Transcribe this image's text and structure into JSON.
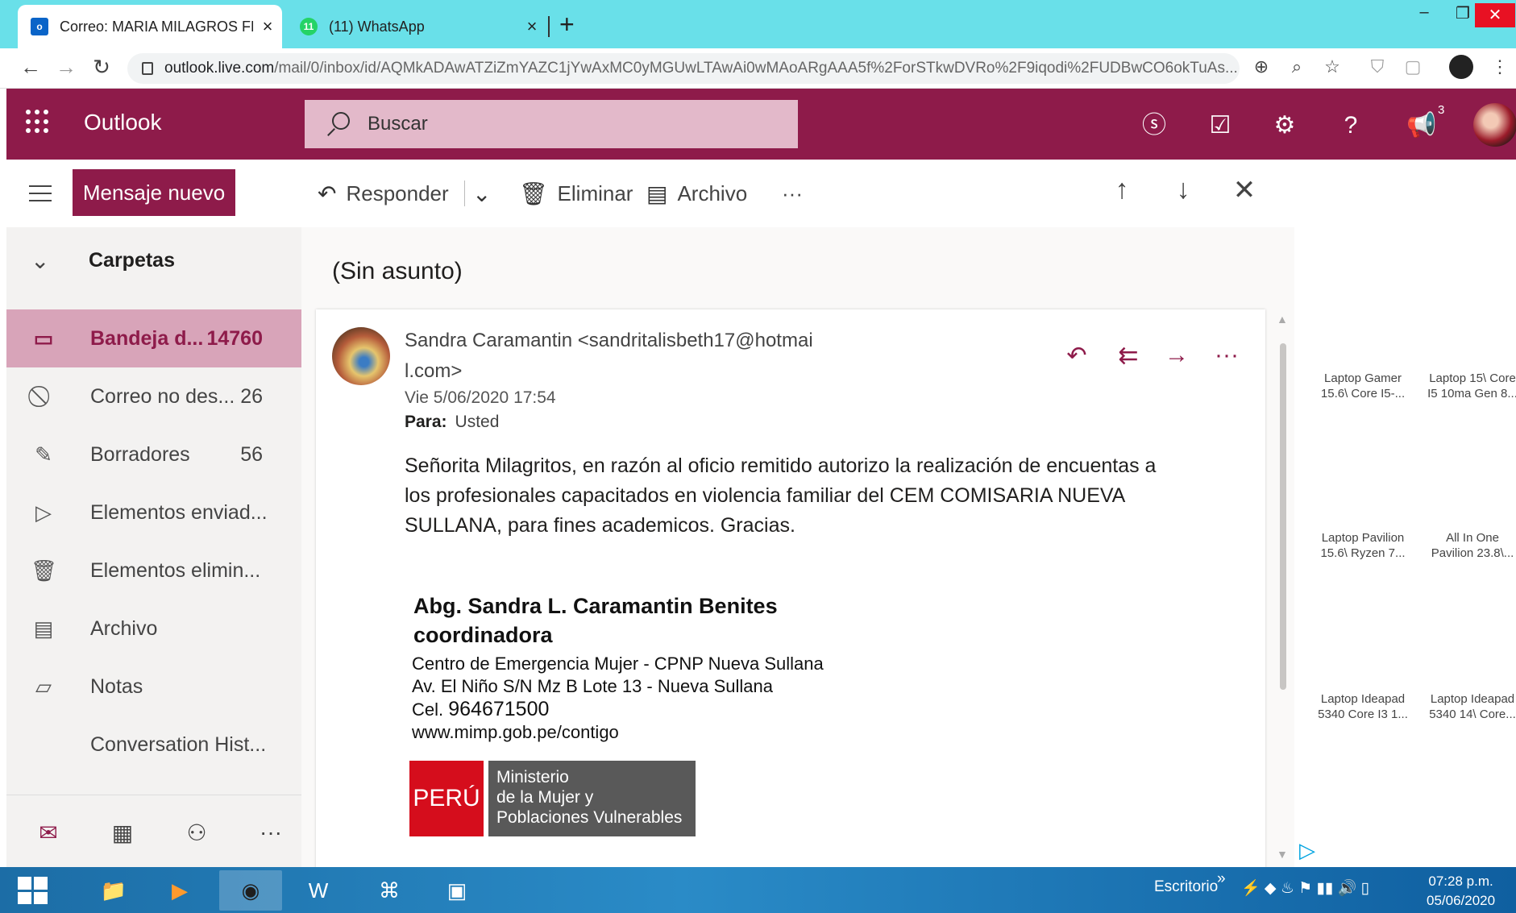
{
  "browser": {
    "tabs": [
      {
        "title": "Correo: MARIA MILAGROS FERNÁ",
        "favicon": "outlook-icon",
        "close": "×"
      },
      {
        "title": "(11) WhatsApp",
        "favicon": "whatsapp-icon",
        "badge": "11",
        "close": "×"
      }
    ],
    "new_tab": "+",
    "url_domain": "outlook.live.com",
    "url_path": "/mail/0/inbox/id/AQMkADAwATZiZmYAZC1jYwAxMC0yMGUwLTAwAi0wMAoARgAAA5f%2ForSTkwDVRo%2F9iqodi%2FUDBwCO6okTuAs..."
  },
  "outlook": {
    "brand": "Outlook",
    "search_placeholder": "Buscar",
    "notification_count": "3",
    "new_message": "Mensaje nuevo",
    "commands": {
      "reply": "Responder",
      "delete": "Eliminar",
      "archive": "Archivo",
      "more": "···"
    }
  },
  "sidebar": {
    "header": "Carpetas",
    "folders": [
      {
        "name": "Bandeja d...",
        "count": "14760",
        "icon": "inbox-icon"
      },
      {
        "name": "Correo no des...",
        "count": "26",
        "icon": "junk-icon"
      },
      {
        "name": "Borradores",
        "count": "56",
        "icon": "pencil-icon"
      },
      {
        "name": "Elementos enviad...",
        "count": "",
        "icon": "send-icon"
      },
      {
        "name": "Elementos elimin...",
        "count": "",
        "icon": "trash-icon"
      },
      {
        "name": "Archivo",
        "count": "",
        "icon": "archive-icon"
      },
      {
        "name": "Notas",
        "count": "",
        "icon": "note-icon"
      },
      {
        "name": "Conversation Hist...",
        "count": "",
        "icon": ""
      }
    ]
  },
  "message": {
    "subject": "(Sin asunto)",
    "sender_line1": "Sandra Caramantin <sandritalisbeth17@hotmai",
    "sender_line2": "l.com>",
    "date": "Vie 5/06/2020 17:54",
    "to_label": "Para:",
    "to_value": "Usted",
    "body_lines": [
      "Señorita Milagritos, en razón al oficio remitido autorizo la realización de encuentas a",
      "los profesionales capacitados en violencia familiar del CEM COMISARIA NUEVA",
      "SULLANA, para fines academicos. Gracias."
    ],
    "signature": {
      "name": "Abg. Sandra L. Caramantin Benites",
      "role": "coordinadora",
      "org": "Centro de Emergencia Mujer - CPNP Nueva Sullana",
      "address": "Av. El Niño S/N Mz B Lote 13 - Nueva Sullana",
      "cel_label": "Cel.",
      "cel_value": "964671500",
      "web": "www.mimp.gob.pe/contigo",
      "logo_left": "PERÚ",
      "logo_lines": [
        "Ministerio",
        "de la Mujer y",
        "Poblaciones Vulnerables"
      ]
    }
  },
  "ads": [
    {
      "l1": "Laptop Gamer",
      "l2": "15.6\\ Core I5-..."
    },
    {
      "l1": "Laptop 15\\ Core",
      "l2": "I5 10ma Gen 8..."
    },
    {
      "l1": "Laptop Pavilion",
      "l2": "15.6\\ Ryzen 7..."
    },
    {
      "l1": "All In One",
      "l2": "Pavilion 23.8\\..."
    },
    {
      "l1": "Laptop Ideapad",
      "l2": "5340 Core I3 1..."
    },
    {
      "l1": "Laptop Ideapad",
      "l2": "5340 14\\ Core..."
    }
  ],
  "taskbar": {
    "desktop_label": "Escritorio",
    "chevron": "»",
    "time": "07:28 p.m.",
    "date": "05/06/2020"
  },
  "colors": {
    "accent": "#8e1b4a",
    "accent_light": "#d8a4b9",
    "tab_strip": "#69e0e9"
  }
}
